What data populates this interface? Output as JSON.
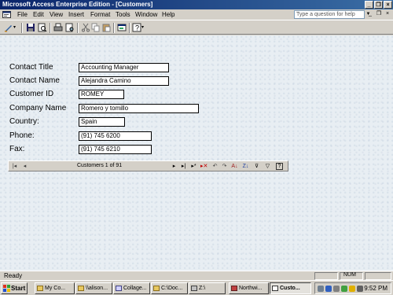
{
  "window": {
    "title": "Microsoft Access Enterprise Edition - [Customers]"
  },
  "menu": {
    "items": [
      "File",
      "Edit",
      "View",
      "Insert",
      "Format",
      "Tools",
      "Window",
      "Help"
    ],
    "help_placeholder": "Type a question for help"
  },
  "form": {
    "fields": [
      {
        "label": "Contact Title",
        "value": "Accounting Manager"
      },
      {
        "label": "Contact Name",
        "value": "Alejandra Camino"
      },
      {
        "label": "Customer ID",
        "value": "ROMEY"
      },
      {
        "label": "Company Name",
        "value": "Romero y tomillo"
      },
      {
        "label": "Country:",
        "value": "Spain"
      },
      {
        "label": "Phone:",
        "value": "(91) 745 6200"
      },
      {
        "label": "Fax:",
        "value": "(91) 745 6210"
      }
    ]
  },
  "navbar": {
    "record_text": "Customers 1 of 91"
  },
  "status": {
    "text": "Ready",
    "num": "NUM"
  },
  "taskbar": {
    "start": "Start",
    "tasks": [
      {
        "label": "My Co..."
      },
      {
        "label": "\\\\alison..."
      },
      {
        "label": "Collage..."
      },
      {
        "label": "C:\\Doc..."
      },
      {
        "label": "Z:\\"
      },
      {
        "label": "Northwi..."
      },
      {
        "label": "Custo..."
      }
    ],
    "clock": "9:52 PM"
  }
}
